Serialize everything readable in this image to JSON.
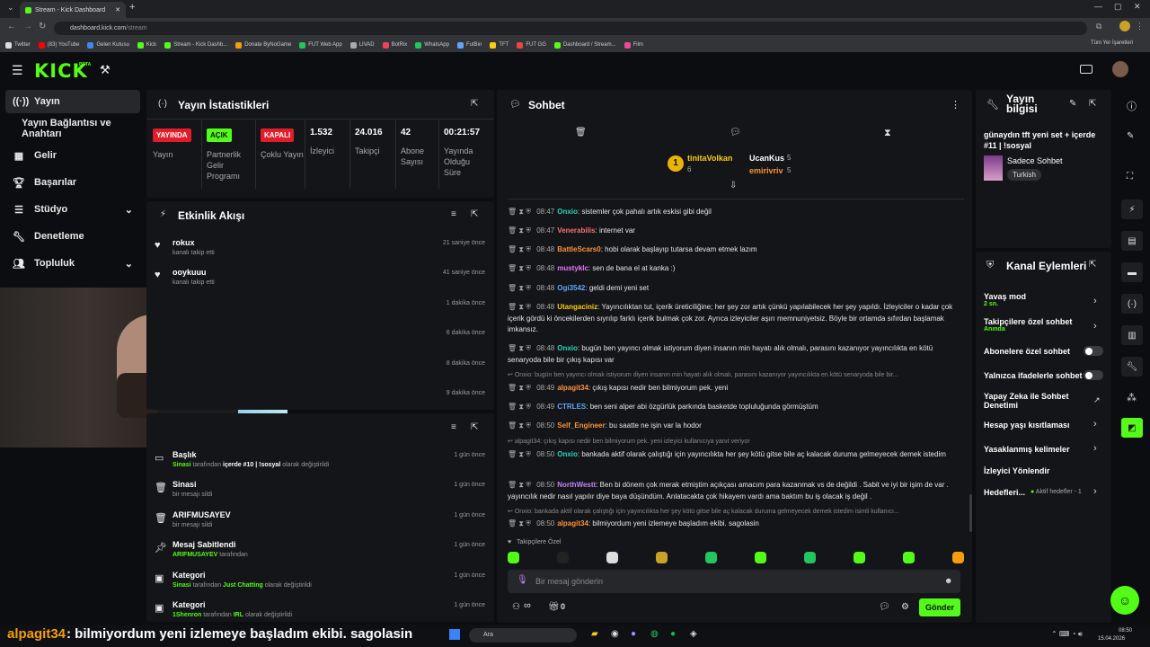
{
  "browser": {
    "tab_title": "Stream - Kick Dashboard",
    "url_host": "dashboard.kick.com",
    "url_path": "/stream",
    "bookmarks": [
      "Twitter",
      "(83) YouTube",
      "Gelen Kutusu",
      "Kick",
      "Stream - Kick Dashb...",
      "Donate ByNoGame",
      "FUT Web App",
      "LIVAD",
      "BotRix",
      "WhatsApp",
      "FutBin",
      "TFT",
      "FUT GG",
      "Dashboard / Stream...",
      "Film"
    ],
    "all_bookmarks": "Tüm Yer İşaretleri"
  },
  "app": {
    "logo": "KICK",
    "logo_beta": "BETA"
  },
  "sidebar": {
    "items": [
      {
        "label": "Yayın",
        "icon": "broadcast-icon"
      },
      {
        "label": "Yayın Bağlantısı ve Anahtarı",
        "icon": ""
      },
      {
        "label": "Gelir",
        "icon": "revenue-icon"
      },
      {
        "label": "Başarılar",
        "icon": "trophy-icon"
      },
      {
        "label": "Stüdyo",
        "icon": "studio-icon"
      },
      {
        "label": "Denetleme",
        "icon": "wrench-icon"
      },
      {
        "label": "Topluluk",
        "icon": "community-icon"
      }
    ]
  },
  "stats": {
    "title": "Yayın İstatistikleri",
    "items": [
      {
        "badge": "YAYINDA",
        "badge_color": "#e11d2a",
        "label": "Yayın"
      },
      {
        "badge": "AÇIK",
        "badge_color": "#53fc18",
        "label": "Partnerlik Gelir Programı"
      },
      {
        "badge": "KAPALI",
        "badge_color": "#e11d2a",
        "label": "Çoklu Yayın"
      },
      {
        "value": "1.532",
        "label": "İzleyici"
      },
      {
        "value": "24.016",
        "label": "Takipçi"
      },
      {
        "value": "42",
        "label": "Abone Sayısı"
      },
      {
        "value": "00:21:57",
        "label": "Yayında Olduğu Süre"
      }
    ]
  },
  "activity": {
    "title": "Etkinlik Akışı",
    "items": [
      {
        "name": "rokux",
        "sub": "kanalı takip etti",
        "time": "21 saniye önce"
      },
      {
        "name": "ooykuuu",
        "sub": "kanalı takip etti",
        "time": "41 saniye önce"
      },
      {
        "name": "",
        "sub": "",
        "time": "1 dakika önce"
      },
      {
        "name": "",
        "sub": "",
        "time": "6 dakika önce"
      },
      {
        "name": "",
        "sub": "",
        "time": "8 dakika önce"
      },
      {
        "name": "",
        "sub": "",
        "time": "9 dakika önce"
      }
    ]
  },
  "modlog": {
    "items": [
      {
        "title": "Başlık",
        "sub_user": "Sinasi",
        "sub_pre": " tarafından ",
        "sub_val": "içerde #10 | !sosyal",
        "sub_post": " olarak değiştirildi",
        "time": "1 gün önce"
      },
      {
        "title": "Sinasi",
        "sub_user": "",
        "sub_pre": "bir mesajı sildi",
        "sub_val": "",
        "sub_post": "",
        "time": "1 gün önce"
      },
      {
        "title": "ARIFMUSAYEV",
        "sub_user": "",
        "sub_pre": "bir mesajı sildi",
        "sub_val": "",
        "sub_post": "",
        "time": "1 gün önce"
      },
      {
        "title": "Mesaj Sabitlendi",
        "sub_user": "ARIFMUSAYEV",
        "sub_pre": " tarafından",
        "sub_val": "",
        "sub_post": "",
        "time": "1 gün önce"
      },
      {
        "title": "Kategori",
        "sub_user": "Sinasi",
        "sub_pre": " tarafından ",
        "sub_val": "Just Chatting",
        "sub_post": " olarak değiştirildi",
        "time": "1 gün önce"
      },
      {
        "title": "Kategori",
        "sub_user": "1Shenron",
        "sub_pre": " tarafından ",
        "sub_val": "IRL",
        "sub_post": " olarak değiştirildi",
        "time": "1 gün önce"
      }
    ]
  },
  "chat": {
    "title": "Sohbet",
    "leaders": [
      {
        "name": "tinitaVolkan",
        "count": "6"
      },
      {
        "name": "UcanKus",
        "count": "5"
      },
      {
        "name": "emirivriv",
        "count": "5"
      }
    ],
    "rank": "1",
    "messages": [
      {
        "time": "08:47",
        "user": "Onxio",
        "color": "#2dd4bf",
        "text": "sistemler çok pahalı artık eskisi gibi değil"
      },
      {
        "time": "08:47",
        "user": "Venerabilis",
        "color": "#f87171",
        "text": "internet var"
      },
      {
        "time": "08:48",
        "user": "BattleScars0",
        "color": "#fb923c",
        "text": "hobi olarak başlayıp tutarsa devam etmek lazım"
      },
      {
        "time": "08:48",
        "user": "mustyklc",
        "color": "#e879f9",
        "text": "sen de bana el at kanka :)"
      },
      {
        "time": "08:48",
        "user": "Ogi3542",
        "color": "#60a5fa",
        "text": "geldi demi yeni set"
      },
      {
        "time": "08:48",
        "user": "Utangaciniz",
        "color": "#facc15",
        "text": "Yayıncılıktan tut, içerik üreticiliğine; her şey zor artık çünkü yapılabilecek her şey yapıldı. İzleyiciler o kadar çok içerik gördü ki öncekilerden sıyrılıp farklı içerik bulmak çok zor. Ayrıca izleyiciler aşırı memnuniyetsiz. Böyle bir ortamda sıfırdan başlamak imkansız."
      },
      {
        "time": "08:48",
        "user": "Onxio",
        "color": "#2dd4bf",
        "text": "bugün ben yayıncı olmak istiyorum diyen insanın min hayatı alık olmalı, parasını kazanıyor yayıncılıkta en kötü senaryoda bile bir çıkış kapısı var"
      },
      {
        "time": "08:49",
        "user": "alpagit34",
        "color": "#fb923c",
        "text": "çıkış kapısı nedir ben bilmiyorum pek. yeni"
      },
      {
        "time": "08:49",
        "user": "CTRLES",
        "color": "#60a5fa",
        "text": "ben seni alper abi özgürlük parkında basketde topluluğunda görmüştüm"
      },
      {
        "time": "08:50",
        "user": "Self_Engineer",
        "color": "#fb923c",
        "text": "bu saatte ne işin var la hodor"
      },
      {
        "time": "08:50",
        "user": "Onxio",
        "color": "#2dd4bf",
        "text": "bankada aktif olarak çalıştığı için yayıncılıkta her şey kötü gitse bile aç kalacak duruma gelmeyecek demek istedim"
      },
      {
        "time": "08:50",
        "user": "NorthWestt",
        "color": "#c084fc",
        "text": "Ben bi dönem çok merak etmiştim açıkçası amacım para kazanmak vs de değildi . Sabit ve iyi bir işim de var . yayıncılık nedir nasıl yapılır diye baya düşündüm. Anlatacakta çok hikayem vardı ama baktım bu iş olacak iş değil ."
      },
      {
        "time": "08:50",
        "user": "alpagit34",
        "color": "#fb923c",
        "text": "bilmiyordum yeni izlemeye başladım ekibi. sagolasin"
      }
    ],
    "replies": [
      "Onxio: bugün ben yayıncı olmak istiyorum diyen insanın min hayatı alık olmalı, parasını kazanıyor yayıncılıkta en kötü senaryoda bile bir...",
      "alpagit34: çıkış kapısı nedir ben bilmiyorum pek. yeni izleyici kullanıcıya yanıt veriyor",
      "Onxio: bankada aktif olarak çalıştığı için yayıncılıkta her şey kötü gitse bile aç kalacak duruma gelmeyecek demek istedim isimli kullanıcı..."
    ],
    "followers_only": "Takipçilere Özel",
    "input_placeholder": "Bir mesaj gönderin",
    "infinity": "∞",
    "zero": "0",
    "send": "Gönder"
  },
  "stream_info": {
    "title": "Yayın bilgisi",
    "stream_title": "günaydın tft yeni set + içerde #11 | !sosyal",
    "category": "Sadece Sohbet",
    "tag": "Turkish"
  },
  "channel_actions": {
    "title": "Kanal Eylemleri",
    "slow_mode": "Yavaş mod",
    "slow_mode_val": "2 sn.",
    "followers_only": "Takipçilere özel sohbet",
    "followers_only_val": "Anında",
    "subs_only": "Abonelere özel sohbet",
    "emotes_only": "Yalnızca ifadelerle sohbet",
    "ai_mod": "Yapay Zeka ile Sohbet Denetimi",
    "account_age": "Hesap yaşı kısıtlaması",
    "banned_words": "Yasaklanmış kelimeler",
    "raid": "İzleyici Yönlendir",
    "goals": "Hedefleri...",
    "goals_val": "Aktif hedefler - 1"
  },
  "overlay": {
    "user": "alpagit34",
    "text": ": bilmiyordum yeni izlemeye başladım ekibi. sagolasin"
  },
  "taskbar": {
    "search": "Ara",
    "time": "08:50",
    "date": "15.04.2026"
  }
}
